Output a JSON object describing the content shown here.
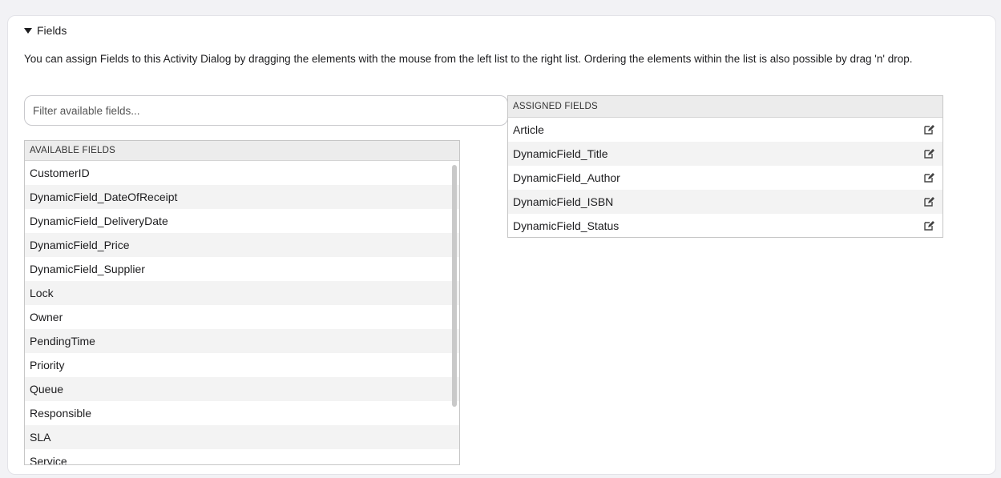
{
  "section": {
    "title": "Fields",
    "description": "You can assign Fields to this Activity Dialog by dragging the elements with the mouse from the left list to the right list. Ordering the elements within the list is also possible by drag 'n' drop."
  },
  "filter": {
    "placeholder": "Filter available fields..."
  },
  "available": {
    "header": "AVAILABLE FIELDS",
    "items": [
      "CustomerID",
      "DynamicField_DateOfReceipt",
      "DynamicField_DeliveryDate",
      "DynamicField_Price",
      "DynamicField_Supplier",
      "Lock",
      "Owner",
      "PendingTime",
      "Priority",
      "Queue",
      "Responsible",
      "SLA",
      "Service"
    ]
  },
  "assigned": {
    "header": "ASSIGNED FIELDS",
    "items": [
      "Article",
      "DynamicField_Title",
      "DynamicField_Author",
      "DynamicField_ISBN",
      "DynamicField_Status"
    ],
    "edit_icon": "edit-icon"
  }
}
